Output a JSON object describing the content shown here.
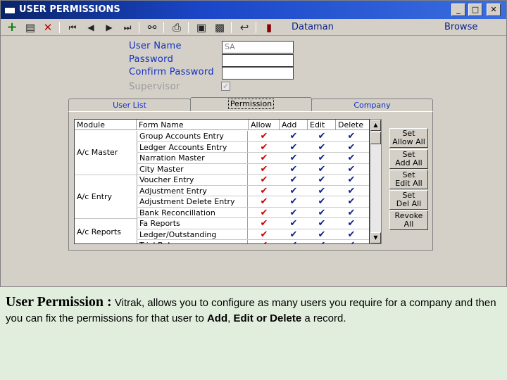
{
  "window": {
    "title": "USER PERMISSIONS",
    "minimize": "_",
    "restore": "□",
    "close": "✕"
  },
  "toolbar": {
    "company": "Dataman",
    "mode": "Browse",
    "icons": [
      "add-icon",
      "clipboard-icon",
      "delete-icon",
      "first-record-icon",
      "prev-record-icon",
      "next-record-icon",
      "last-record-icon",
      "binoculars-icon",
      "print-icon",
      "save-icon",
      "save-as-icon",
      "undo-icon",
      "exit-icon"
    ]
  },
  "form": {
    "user_name_label": "User Name",
    "user_name_value": "SA",
    "password_label": "Password",
    "password_value": "",
    "confirm_password_label": "Confirm Password",
    "confirm_password_value": "",
    "supervisor_label": "Supervisor",
    "supervisor_checked": "✓"
  },
  "tabs": [
    {
      "label": "User List"
    },
    {
      "label": "Permission"
    },
    {
      "label": "Company"
    }
  ],
  "grid": {
    "headers": [
      "Module",
      "Form Name",
      "Allow",
      "Add",
      "Edit",
      "Delete"
    ],
    "modules": [
      "A/c Master",
      "A/c Entry",
      "A/c Reports"
    ],
    "rows": [
      {
        "form": "Group Accounts Entry",
        "allow": "✔",
        "add": "✔",
        "edit": "✔",
        "delete": "✔"
      },
      {
        "form": "Ledger Accounts Entry",
        "allow": "✔",
        "add": "✔",
        "edit": "✔",
        "delete": "✔"
      },
      {
        "form": "Narration Master",
        "allow": "✔",
        "add": "✔",
        "edit": "✔",
        "delete": "✔"
      },
      {
        "form": "City Master",
        "allow": "✔",
        "add": "✔",
        "edit": "✔",
        "delete": "✔"
      },
      {
        "form": "Voucher Entry",
        "allow": "✔",
        "add": "✔",
        "edit": "✔",
        "delete": "✔"
      },
      {
        "form": "Adjustment Entry",
        "allow": "✔",
        "add": "✔",
        "edit": "✔",
        "delete": "✔"
      },
      {
        "form": "Adjustment Delete Entry",
        "allow": "✔",
        "add": "✔",
        "edit": "✔",
        "delete": "✔"
      },
      {
        "form": "Bank Reconcillation",
        "allow": "✔",
        "add": "✔",
        "edit": "✔",
        "delete": "✔"
      },
      {
        "form": "Fa Reports",
        "allow": "✔",
        "add": "✔",
        "edit": "✔",
        "delete": "✔"
      },
      {
        "form": "Ledger/Outstanding",
        "allow": "✔",
        "add": "✔",
        "edit": "✔",
        "delete": "✔"
      },
      {
        "form": "Trial Bal",
        "allow": "✔",
        "add": "✔",
        "edit": "✔",
        "delete": "✔"
      }
    ]
  },
  "side_buttons": [
    {
      "line1": "Set",
      "line2": "Allow All"
    },
    {
      "line1": "Set",
      "line2": "Add All"
    },
    {
      "line1": "Set",
      "line2": "Edit All"
    },
    {
      "line1": "Set",
      "line2": "Del All"
    },
    {
      "line1": "Revoke",
      "line2": "All"
    }
  ],
  "caption": {
    "lead": "User Permission :",
    "text1": " Vitrak, allows you to configure as many users you require  for a company and then you can fix the permissions for that user to ",
    "add": "Add",
    "comma": ", ",
    "edit_delete": "Edit or Delete",
    "text2": " a record."
  },
  "colors": {
    "title_bar": "#0a246a",
    "label_blue": "#1030c0",
    "check_red": "#cc0000",
    "check_blue": "#0a1e8c",
    "background": "#e1eedd"
  }
}
